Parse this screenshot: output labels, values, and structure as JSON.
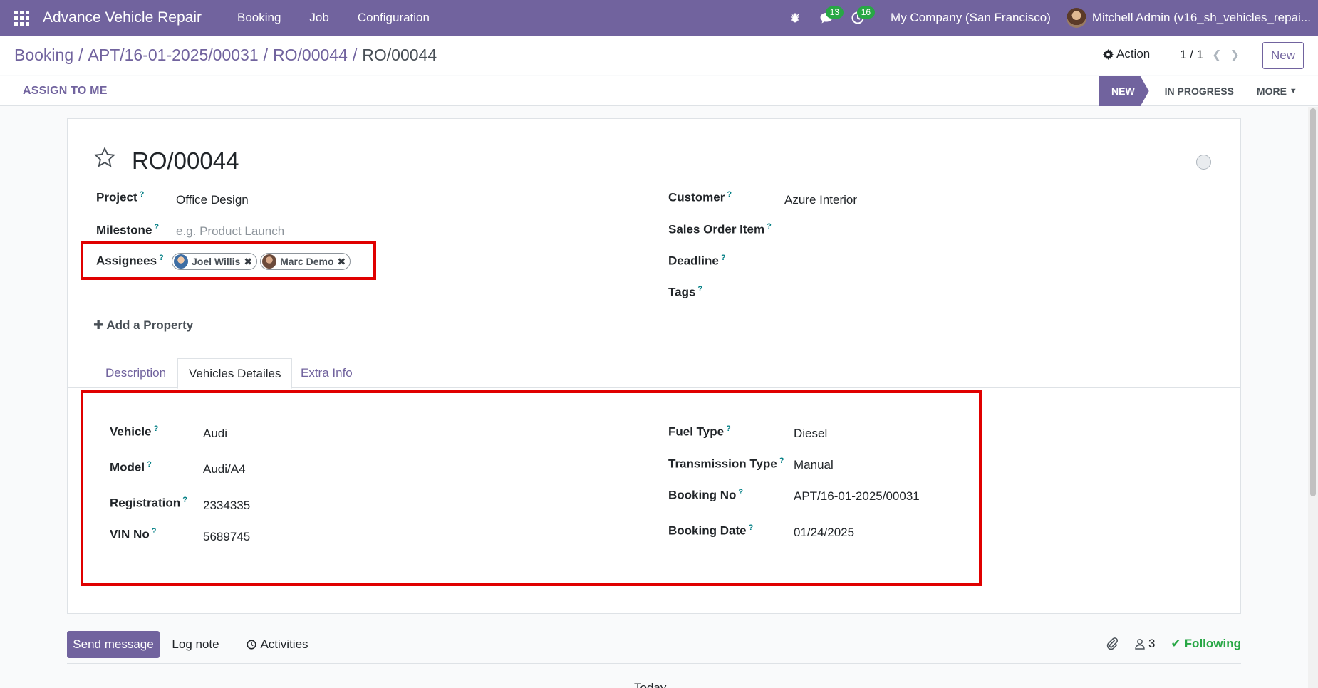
{
  "navbar": {
    "brand": "Advance Vehicle Repair",
    "menu": [
      "Booking",
      "Job",
      "Configuration"
    ],
    "messages_count": "13",
    "activities_count": "16",
    "company": "My Company (San Francisco)",
    "user": "Mitchell Admin (v16_sh_vehicles_repai..."
  },
  "breadcrumb": {
    "items": [
      "Booking",
      "APT/16-01-2025/00031",
      "RO/00044"
    ],
    "current": "RO/00044",
    "separator": "/"
  },
  "control": {
    "action_label": "Action",
    "pager": "1 / 1",
    "new_label": "New"
  },
  "statusbar": {
    "assign_label": "ASSIGN TO ME",
    "stages": [
      "NEW",
      "IN PROGRESS",
      "MORE"
    ],
    "active_stage": "NEW"
  },
  "form": {
    "title": "RO/00044",
    "left": {
      "project_label": "Project",
      "project_value": "Office Design",
      "milestone_label": "Milestone",
      "milestone_placeholder": "e.g. Product Launch",
      "assignees_label": "Assignees",
      "assignees": [
        "Joel Willis",
        "Marc Demo"
      ]
    },
    "right": {
      "customer_label": "Customer",
      "customer_value": "Azure Interior",
      "sales_order_label": "Sales Order Item",
      "deadline_label": "Deadline",
      "tags_label": "Tags"
    },
    "help_mark": "?",
    "add_property_label": "Add a Property"
  },
  "tabs": {
    "items": [
      "Description",
      "Vehicles Detailes",
      "Extra Info"
    ],
    "active": "Vehicles Detailes"
  },
  "vehicle": {
    "vehicle_label": "Vehicle",
    "vehicle_value": "Audi",
    "model_label": "Model",
    "model_value": "Audi/A4",
    "registration_label": "Registration",
    "registration_value": "2334335",
    "vin_label": "VIN No",
    "vin_value": "5689745",
    "fuel_label": "Fuel Type",
    "fuel_value": "Diesel",
    "transmission_label": "Transmission Type",
    "transmission_value": "Manual",
    "booking_no_label": "Booking No",
    "booking_no_value": "APT/16-01-2025/00031",
    "booking_date_label": "Booking Date",
    "booking_date_value": "01/24/2025"
  },
  "chatter": {
    "send_label": "Send message",
    "log_label": "Log note",
    "activities_label": "Activities",
    "followers_count": "3",
    "following_label": "Following",
    "bottom_text": "Today"
  },
  "colors": {
    "brand": "#71639e",
    "highlight": "#e00000",
    "success": "#28a745",
    "help": "#017e84"
  },
  "icons": [
    "apps-grid-icon",
    "bug-icon",
    "chat-icon",
    "clock-icon",
    "gear-icon",
    "chevron-left-icon",
    "chevron-right-icon",
    "caret-down-icon",
    "star-icon",
    "plus-icon",
    "close-icon",
    "paperclip-icon",
    "user-icon",
    "check-icon"
  ]
}
